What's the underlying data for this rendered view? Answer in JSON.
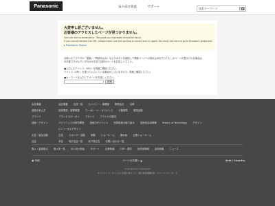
{
  "header": {
    "logo": "Panasonic",
    "nav": [
      "法人向け商品",
      "サポート"
    ],
    "search_placeholder": "検索キーワード"
  },
  "error": {
    "title_line1": "大変申し訳ございません。",
    "title_line2": "お客様のアクセスしたページが見つかりません。",
    "english_line1": "Sorry for the inconvenience. The page you requested cannot be found.",
    "english_line2": "If you cannot retrieve the URL, please make sure the spelling is correct and try again. You may click here to go to Panasonic global site.",
    "global_link": "Panasonic Global",
    "body_line1": "お使いのブラウザの「更新」・「再読み込み」などのボタンを使用して再度ページへの読み込みを行ってもこのページが表示される場合は、",
    "body_line2": "お手数ですが以下いずれかの方法で目的のページをお探しください。",
    "body_line3": "■入力したアドレス（URL）を再度ご確認ください。",
    "body_line4": "アドレス（URL）を誤って入力している場合がございますので、再度ご確認ください。",
    "body_line5": "■キーワードを入力してページをお探しください。",
    "search_button": "検索"
  },
  "footer": {
    "rows": [
      {
        "cat": "会社情報",
        "items": [
          "会社概要",
          "社員一覧",
          "カンパニー・事業部",
          "関係会社",
          "沿革"
        ]
      },
      {
        "cat": "経営の考え方",
        "items": [
          "経営理念・事業概要",
          "コーポレート・ガバナンス",
          "行動基準",
          "調達活動"
        ]
      },
      {
        "cat": "ブランド",
        "items": [
          "ブランドスローガン",
          "ブランド",
          "ブランドの歴史"
        ]
      },
      {
        "cat": "技術・デザイン",
        "items": [
          "パナソニックの研究開発",
          "技術力IPイベント",
          "知的財産の取り組み",
          "技術系採用情報",
          "History of Technology",
          "デザイン",
          "ユニバーサルデザイン"
        ]
      },
      {
        "cat": "広告・宣伝活動",
        "items": [
          "広告",
          "スポンサー活動",
          "体験",
          "ショールーム",
          "展示会",
          "企業ショールーム"
        ]
      },
      {
        "cat": "社会",
        "items": [
          "本社",
          "地方支店一覧",
          "地下鉄広告",
          "お問い合わせ一覧"
        ]
      },
      {
        "cat": "購入・直接取引",
        "items": [
          "購入先一覧",
          "法人向け商品",
          "サポート",
          "企業情報",
          "CSR・環境",
          "投資家情報",
          "採用情報",
          "ニュース"
        ]
      }
    ],
    "print": "印刷",
    "page_top": "ページの先頭へ",
    "region": "Asia / Country",
    "copyright": "© Panasonic Corporation",
    "sitemap": "サイトマップ｜サイトのご利用にあたって｜個人情報保護方針｜パナソニック・ホーム"
  }
}
